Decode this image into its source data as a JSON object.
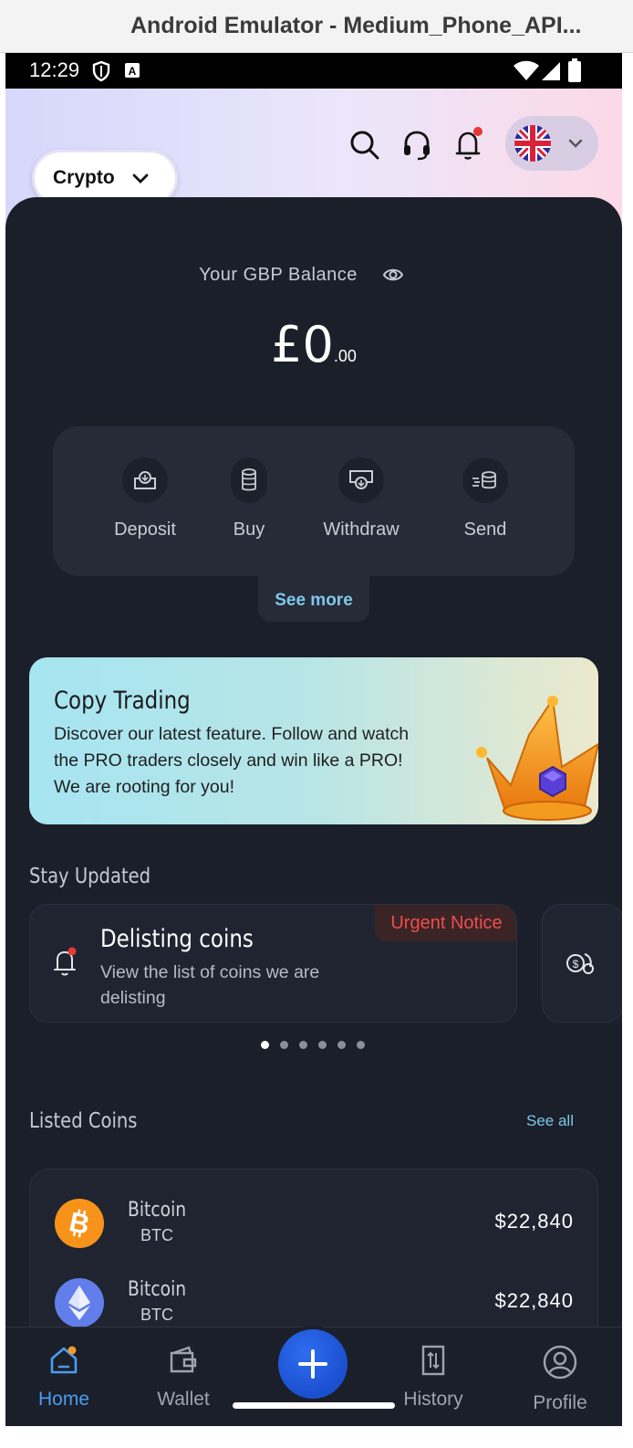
{
  "window": {
    "title": "Android Emulator - Medium_Phone_API..."
  },
  "status_bar": {
    "time": "12:29"
  },
  "header": {
    "mode_selector": "Crypto",
    "icons": [
      "search-icon",
      "headset-icon",
      "bell-icon",
      "uk-flag-icon",
      "chevron-down-icon"
    ]
  },
  "balance": {
    "label": "Your GBP Balance",
    "amount_main": "£0",
    "amount_decimal": ".00"
  },
  "actions": [
    {
      "label": "Deposit",
      "icon": "deposit-icon"
    },
    {
      "label": "Buy",
      "icon": "coins-stack-icon"
    },
    {
      "label": "Withdraw",
      "icon": "withdraw-icon"
    },
    {
      "label": "Send",
      "icon": "send-coins-icon"
    }
  ],
  "see_more": "See more",
  "copy_trading": {
    "title": "Copy Trading",
    "description": "Discover our latest feature. Follow and watch the PRO traders closely and win like a PRO! We are rooting for you!"
  },
  "stay_updated": {
    "title": "Stay Updated",
    "cards": [
      {
        "badge": "Urgent Notice",
        "title": "Delisting coins",
        "description": "View the list of coins we are delisting"
      }
    ],
    "dots_total": 6,
    "dots_active": 1
  },
  "listed_coins": {
    "title": "Listed Coins",
    "see_all": "See all",
    "coins": [
      {
        "name": "Bitcoin",
        "symbol": "BTC",
        "price": "$22,840",
        "color": "#f7931a"
      },
      {
        "name": "Bitcoin",
        "symbol": "BTC",
        "price": "$22,840",
        "color": "#627eea"
      }
    ]
  },
  "bottom_nav": {
    "items": [
      {
        "label": "Home",
        "active": true
      },
      {
        "label": "Wallet",
        "active": false
      },
      {
        "label": "History",
        "active": false
      },
      {
        "label": "Profile",
        "active": false
      }
    ]
  },
  "colors": {
    "accent_blue": "#4a9cf2",
    "link_blue": "#7fc7ea",
    "urgent_red": "#ef4c4c",
    "panel_dark": "#1a1f29"
  }
}
